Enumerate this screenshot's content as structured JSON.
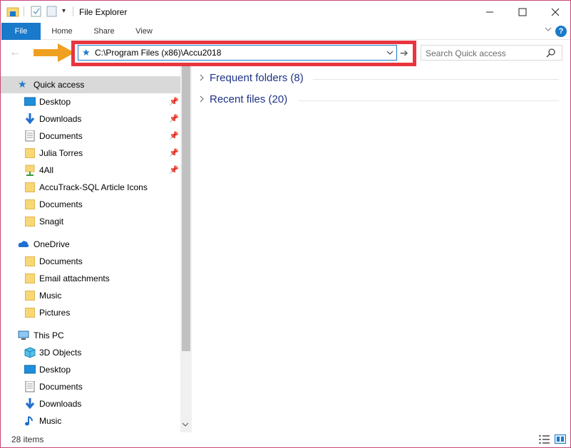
{
  "window": {
    "title": "File Explorer"
  },
  "ribbon": {
    "tabs": [
      {
        "label": "File"
      },
      {
        "label": "Home"
      },
      {
        "label": "Share"
      },
      {
        "label": "View"
      }
    ],
    "help": "?"
  },
  "address_bar": {
    "path": "C:\\Program Files (x86)\\Accu2018",
    "search_placeholder": "Search Quick access"
  },
  "nav": {
    "quick_access": {
      "label": "Quick access",
      "items": [
        {
          "label": "Desktop",
          "icon": "desktop-icon",
          "pinned": true
        },
        {
          "label": "Downloads",
          "icon": "download-icon",
          "pinned": true
        },
        {
          "label": "Documents",
          "icon": "document-icon",
          "pinned": true
        },
        {
          "label": "Julia Torres",
          "icon": "folder-icon",
          "pinned": true
        },
        {
          "label": "4All",
          "icon": "network-folder-icon",
          "pinned": true
        },
        {
          "label": "AccuTrack-SQL Article Icons",
          "icon": "folder-icon",
          "pinned": false
        },
        {
          "label": "Documents",
          "icon": "folder-icon",
          "pinned": false
        },
        {
          "label": "Snagit",
          "icon": "folder-icon",
          "pinned": false
        }
      ]
    },
    "onedrive": {
      "label": "OneDrive",
      "items": [
        {
          "label": "Documents",
          "icon": "folder-icon"
        },
        {
          "label": "Email attachments",
          "icon": "folder-icon"
        },
        {
          "label": "Music",
          "icon": "folder-icon"
        },
        {
          "label": "Pictures",
          "icon": "folder-icon"
        }
      ]
    },
    "this_pc": {
      "label": "This PC",
      "items": [
        {
          "label": "3D Objects",
          "icon": "cube-icon"
        },
        {
          "label": "Desktop",
          "icon": "desktop-icon"
        },
        {
          "label": "Documents",
          "icon": "document-icon"
        },
        {
          "label": "Downloads",
          "icon": "download-icon"
        },
        {
          "label": "Music",
          "icon": "music-icon"
        }
      ]
    }
  },
  "content": {
    "groups": [
      {
        "label": "Frequent folders (8)"
      },
      {
        "label": "Recent files (20)"
      }
    ]
  },
  "status": {
    "item_count": "28 items"
  },
  "colors": {
    "accent": "#1979ca",
    "highlight_box": "#e8353f",
    "arrow": "#f0a020",
    "group_label": "#1e3287",
    "selected_bg": "#d9d9d9"
  }
}
